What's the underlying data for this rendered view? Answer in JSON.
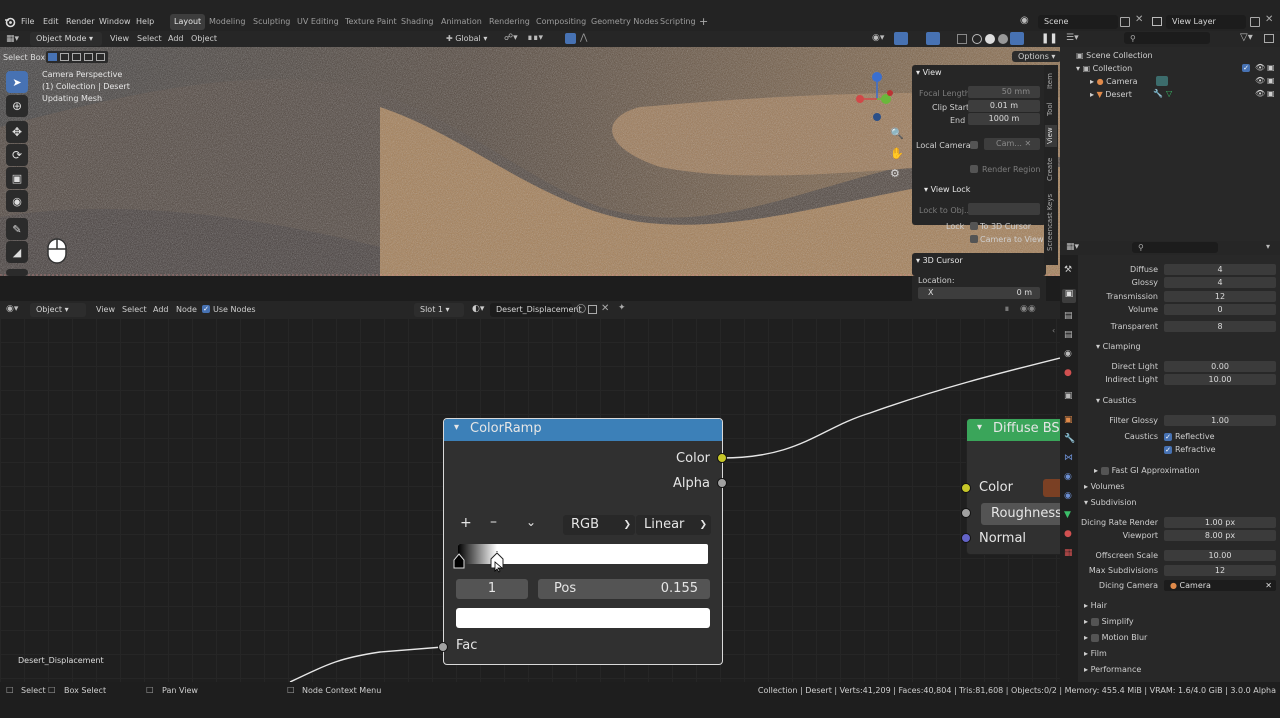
{
  "menu": [
    "File",
    "Edit",
    "Render",
    "Window",
    "Help"
  ],
  "workspaces": [
    "Layout",
    "Modeling",
    "Sculpting",
    "UV Editing",
    "Texture Paint",
    "Shading",
    "Animation",
    "Rendering",
    "Compositing",
    "Geometry Nodes",
    "Scripting"
  ],
  "scene_name": "Scene",
  "view_layer": "View Layer",
  "viewport_header": {
    "mode": "Object Mode",
    "view": "View",
    "select": "Select",
    "add": "Add",
    "object": "Object",
    "orientation": "Global",
    "options": "Options"
  },
  "select_box": "Select Box",
  "overlay": {
    "line1": "Camera Perspective",
    "line2": "(1) Collection | Desert",
    "line3": "Updating Mesh"
  },
  "n_panel": {
    "tabs": [
      "Item",
      "Tool",
      "View",
      "Create",
      "Screencast Keys"
    ],
    "view_title": "View",
    "focal_length_label": "Focal Length",
    "focal_length": "50 mm",
    "clip_start_label": "Clip Start",
    "clip_start": "0.01 m",
    "end_label": "End",
    "end": "1000 m",
    "local_camera_label": "Local Camera",
    "local_camera_value": "Cam...",
    "render_region": "Render Region",
    "view_lock_title": "View Lock",
    "lock_to_obj_label": "Lock to Obj...",
    "lock_label": "Lock",
    "to_3d_cursor": "To 3D Cursor",
    "camera_to_view": "Camera to View",
    "cursor_title": "3D Cursor",
    "location_label": "Location:",
    "x_label": "X",
    "x_value": "0 m"
  },
  "node_header": {
    "editor": "Object",
    "view": "View",
    "select": "Select",
    "add": "Add",
    "node": "Node",
    "use_nodes": "Use Nodes",
    "slot": "Slot 1",
    "material": "Desert_Displacement"
  },
  "colorramp": {
    "title": "ColorRamp",
    "out_color": "Color",
    "out_alpha": "Alpha",
    "color_mode": "RGB",
    "interpolation": "Linear",
    "stop_index": "1",
    "pos_label": "Pos",
    "pos_value": "0.155",
    "in_fac": "Fac",
    "stop_position": 0.155
  },
  "diffuse": {
    "title": "Diffuse BSDF",
    "color": "Color",
    "roughness": "Roughness",
    "normal": "Normal"
  },
  "material_label": "Desert_Displacement",
  "outliner": {
    "root": "Scene Collection",
    "collection": "Collection",
    "items": [
      "Camera",
      "Desert"
    ]
  },
  "props": {
    "bounces": [
      {
        "label": "Diffuse",
        "value": "4"
      },
      {
        "label": "Glossy",
        "value": "4"
      },
      {
        "label": "Transmission",
        "value": "12"
      },
      {
        "label": "Volume",
        "value": "0"
      },
      {
        "label": "Transparent",
        "value": "8"
      }
    ],
    "clamping_title": "Clamping",
    "direct_light_label": "Direct Light",
    "direct_light": "0.00",
    "indirect_light_label": "Indirect Light",
    "indirect_light": "10.00",
    "caustics_title": "Caustics",
    "filter_glossy_label": "Filter Glossy",
    "filter_glossy": "1.00",
    "caustics_label": "Caustics",
    "reflective": "Reflective",
    "refractive": "Refractive",
    "fast_gi": "Fast GI Approximation",
    "volumes": "Volumes",
    "subdivision": "Subdivision",
    "dicing_rate_label": "Dicing Rate Render",
    "dicing_rate": "1.00 px",
    "viewport_label": "Viewport",
    "viewport": "8.00 px",
    "offscreen_label": "Offscreen Scale",
    "offscreen": "10.00",
    "max_subdiv_label": "Max Subdivisions",
    "max_subdiv": "12",
    "dicing_camera_label": "Dicing Camera",
    "dicing_camera": "Camera",
    "hair": "Hair",
    "simplify": "Simplify",
    "motion_blur": "Motion Blur",
    "film": "Film",
    "performance": "Performance"
  },
  "status": {
    "select": "Select",
    "box_select": "Box Select",
    "pan_view": "Pan View",
    "context_menu": "Node Context Menu",
    "info": "Collection | Desert | Verts:41,209 | Faces:40,804 | Tris:81,608 | Objects:0/2 | Memory: 455.4 MiB | VRAM: 1.6/4.0 GiB | 3.0.0 Alpha"
  },
  "colors": {
    "accent": "#4772b3",
    "node_header": "#3c80b8",
    "diffuse_header": "#3aa55a",
    "socket_yellow": "#c7c729",
    "socket_gray": "#a1a1a1",
    "socket_blue": "#6363c7"
  }
}
